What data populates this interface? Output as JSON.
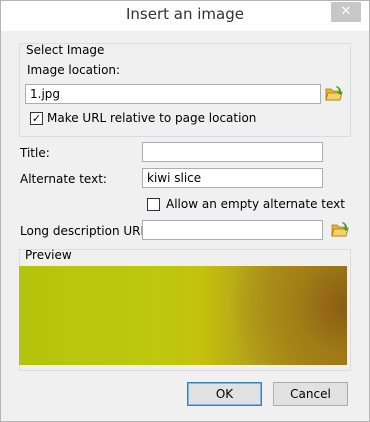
{
  "window": {
    "title": "Insert an image",
    "close_glyph": "✕"
  },
  "select_image": {
    "legend": "Select Image",
    "location_label": "Image location:",
    "location_value": "1.jpg",
    "relative_label": "Make URL relative to page location",
    "relative_checked": true
  },
  "fields": {
    "title_label": "Title:",
    "title_value": "",
    "alt_label": "Alternate text:",
    "alt_value": "kiwi slice",
    "allow_empty_label": "Allow an empty alternate text",
    "allow_empty_checked": false,
    "longdesc_label": "Long description URI:",
    "longdesc_value": ""
  },
  "preview": {
    "legend": "Preview"
  },
  "buttons": {
    "ok": "OK",
    "cancel": "Cancel"
  },
  "icons": {
    "browse": "folder-open-icon"
  },
  "colors": {
    "accent": "#3c7fb1",
    "folder": "#e8b62c",
    "arrow": "#3a9d23"
  }
}
